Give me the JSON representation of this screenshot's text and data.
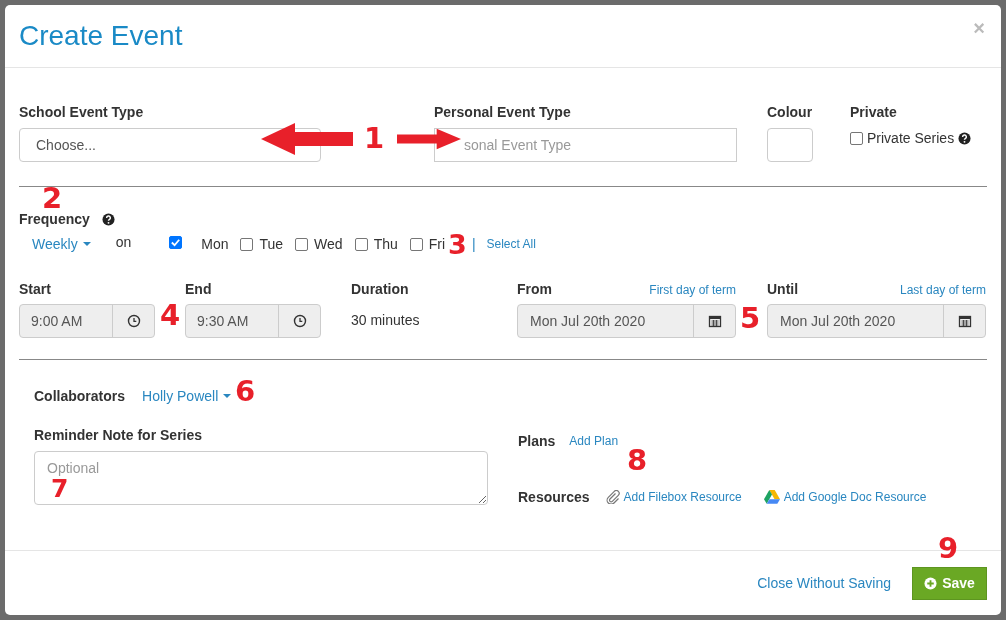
{
  "modal": {
    "title": "Create Event",
    "close": "×"
  },
  "event_type": {
    "school_label": "School Event Type",
    "school_value": "Choose...",
    "personal_label": "Personal Event Type",
    "personal_placeholder": "sonal Event Type",
    "colour_label": "Colour",
    "private_label": "Private",
    "private_series": {
      "label": "Private Series",
      "checked": false
    }
  },
  "frequency": {
    "label": "Frequency",
    "value": "Weekly",
    "on": "on",
    "days": [
      {
        "label": "Mon",
        "checked": true
      },
      {
        "label": "Tue",
        "checked": false
      },
      {
        "label": "Wed",
        "checked": false
      },
      {
        "label": "Thu",
        "checked": false
      },
      {
        "label": "Fri",
        "checked": false
      }
    ],
    "separator": "|",
    "select_all": "Select All"
  },
  "times": {
    "start_label": "Start",
    "start": "9:00 AM",
    "end_label": "End",
    "end": "9:30 AM",
    "duration_label": "Duration",
    "duration": "30 minutes",
    "from_label": "From",
    "from_link": "First day of term",
    "from": "Mon Jul 20th 2020",
    "until_label": "Until",
    "until_link": "Last day of term",
    "until": "Mon Jul 20th 2020"
  },
  "collaborators": {
    "label": "Collaborators",
    "value": "Holly Powell"
  },
  "reminder": {
    "label": "Reminder Note for Series",
    "placeholder": "Optional"
  },
  "plans": {
    "label": "Plans",
    "link": "Add Plan"
  },
  "resources": {
    "label": "Resources",
    "filebox": "Add Filebox Resource",
    "google": "Add Google Doc Resource"
  },
  "footer": {
    "close": "Close Without Saving",
    "save": "Save"
  },
  "annotations": [
    {
      "kind": "double-arrow",
      "label": "1"
    },
    {
      "kind": "number",
      "label": "2"
    },
    {
      "kind": "number",
      "label": "3"
    },
    {
      "kind": "number",
      "label": "4"
    },
    {
      "kind": "number",
      "label": "5"
    },
    {
      "kind": "number",
      "label": "6"
    },
    {
      "kind": "number",
      "label": "7"
    },
    {
      "kind": "number",
      "label": "8"
    },
    {
      "kind": "number",
      "label": "9"
    }
  ]
}
